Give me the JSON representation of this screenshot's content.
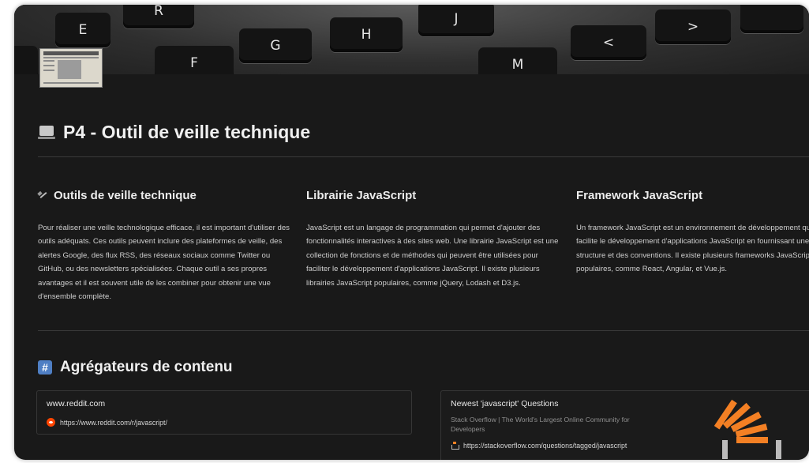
{
  "cover": {
    "keys": [
      "E",
      "R",
      "F",
      "G",
      "H",
      "J",
      "M",
      "<",
      ">"
    ]
  },
  "page": {
    "title": "P4 - Outil de veille technique"
  },
  "columns": [
    {
      "heading": "Outils de veille technique",
      "body": "Pour réaliser une veille technologique efficace, il est important d'utiliser des outils adéquats. Ces outils peuvent inclure des plateformes de veille, des alertes Google, des flux RSS, des réseaux sociaux comme Twitter ou GitHub, ou des newsletters spécialisées. Chaque outil a ses propres avantages et il est souvent utile de les combiner pour obtenir une vue d'ensemble complète."
    },
    {
      "heading": "Librairie JavaScript",
      "body": "JavaScript est un langage de programmation qui permet d'ajouter des fonctionnalités interactives à des sites web. Une librairie JavaScript est une collection de fonctions et de méthodes qui peuvent être utilisées pour faciliter le développement d'applications JavaScript. Il existe plusieurs librairies JavaScript populaires, comme jQuery, Lodash et D3.js."
    },
    {
      "heading": "Framework JavaScript",
      "body": "Un framework JavaScript est un environnement de développement qui facilite le développement d'applications JavaScript en fournissant une structure et des conventions. Il existe plusieurs frameworks JavaScript populaires, comme React, Angular, et Vue.js."
    }
  ],
  "section2": {
    "title": "Agrégateurs de contenu"
  },
  "bookmarks": [
    {
      "title": "www.reddit.com",
      "url": "https://www.reddit.com/r/javascript/",
      "icon": "reddit-icon"
    },
    {
      "title": "Newest 'javascript' Questions",
      "description": "Stack Overflow | The World's Largest Online Community for Developers",
      "url": "https://stackoverflow.com/questions/tagged/javascript",
      "icon": "stackoverflow-icon",
      "logo_color": "#f48024"
    }
  ],
  "colors": {
    "background": "#191919",
    "text": "#f0f0f0",
    "accent_blue": "#4f7fc4",
    "reddit": "#ff4500",
    "stackoverflow": "#f48024"
  }
}
